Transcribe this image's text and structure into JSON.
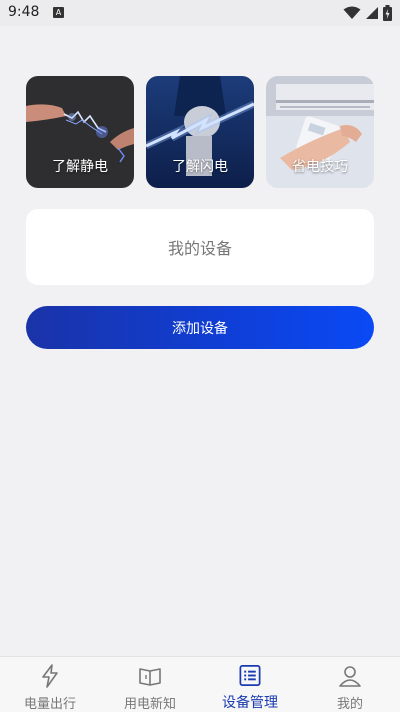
{
  "status_bar": {
    "time": "9:48",
    "notification_icon_letter": "A"
  },
  "cards": [
    {
      "label": "了解静电",
      "icon": "static-electricity-image"
    },
    {
      "label": "了解闪电",
      "icon": "lightning-image"
    },
    {
      "label": "省电技巧",
      "icon": "power-saving-image"
    }
  ],
  "devices": {
    "title": "我的设备"
  },
  "add_device": {
    "label": "添加设备"
  },
  "bottom_nav": {
    "items": [
      {
        "label": "电量出行",
        "icon": "lightning-bolt-icon",
        "active": false
      },
      {
        "label": "用电新知",
        "icon": "open-book-icon",
        "active": false
      },
      {
        "label": "设备管理",
        "icon": "device-list-icon",
        "active": true
      },
      {
        "label": "我的",
        "icon": "person-icon",
        "active": false
      }
    ]
  },
  "colors": {
    "accent": "#1a3bb0",
    "button_gradient_start": "#1a33a8",
    "button_gradient_end": "#0a4af5"
  }
}
